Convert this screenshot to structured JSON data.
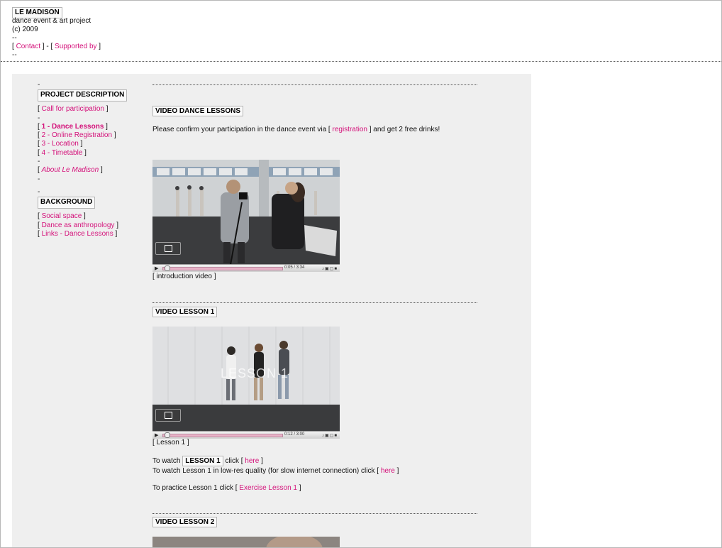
{
  "header": {
    "site_title": "LE MADISON",
    "tagline": "dance event & art project",
    "copyright": "(c) 2009",
    "sep1": "--",
    "sep2": "--",
    "nav": {
      "contact": "Contact",
      "supported_by": "Supported by"
    }
  },
  "sidebar": {
    "dash": "-",
    "project_heading": "PROJECT DESCRIPTION",
    "call": "Call for participation",
    "items": [
      "1 - Dance Lessons",
      "2 - Online Registration",
      "3 - Location",
      "4 - Timetable"
    ],
    "about": "About Le Madison",
    "background_heading": "BACKGROUND",
    "background_items": [
      "Social space",
      "Dance as anthropology",
      "Links - Dance Lessons"
    ]
  },
  "main": {
    "video_dance_heading": "VIDEO DANCE LESSONS",
    "confirm_prefix": "Please confirm your participation in the dance event via [ ",
    "confirm_link": "registration",
    "confirm_suffix": " ] and get 2 free drinks!",
    "intro_caption": "introduction video",
    "intro_time": "0:05 / 3:34",
    "lesson1_heading": "VIDEO LESSON 1",
    "lesson1_overlay": "LESSON 1",
    "lesson1_time": "0:12 / 3:00",
    "lesson1_caption": "Lesson 1",
    "watch_prefix": "To watch",
    "watch_box": "LESSON 1",
    "watch_click": "click [",
    "here": "here",
    "lowres_text": "To watch Lesson 1 in low-res quality (for slow internet connection) click [",
    "practice_text": "To practice Lesson 1 click [",
    "exercise_link": "Exercise Lesson 1",
    "lesson2_heading": "VIDEO LESSON 2"
  },
  "colors": {
    "link": "#d4117a",
    "panel": "#efefef",
    "video_floor": "#3a3b3d"
  }
}
